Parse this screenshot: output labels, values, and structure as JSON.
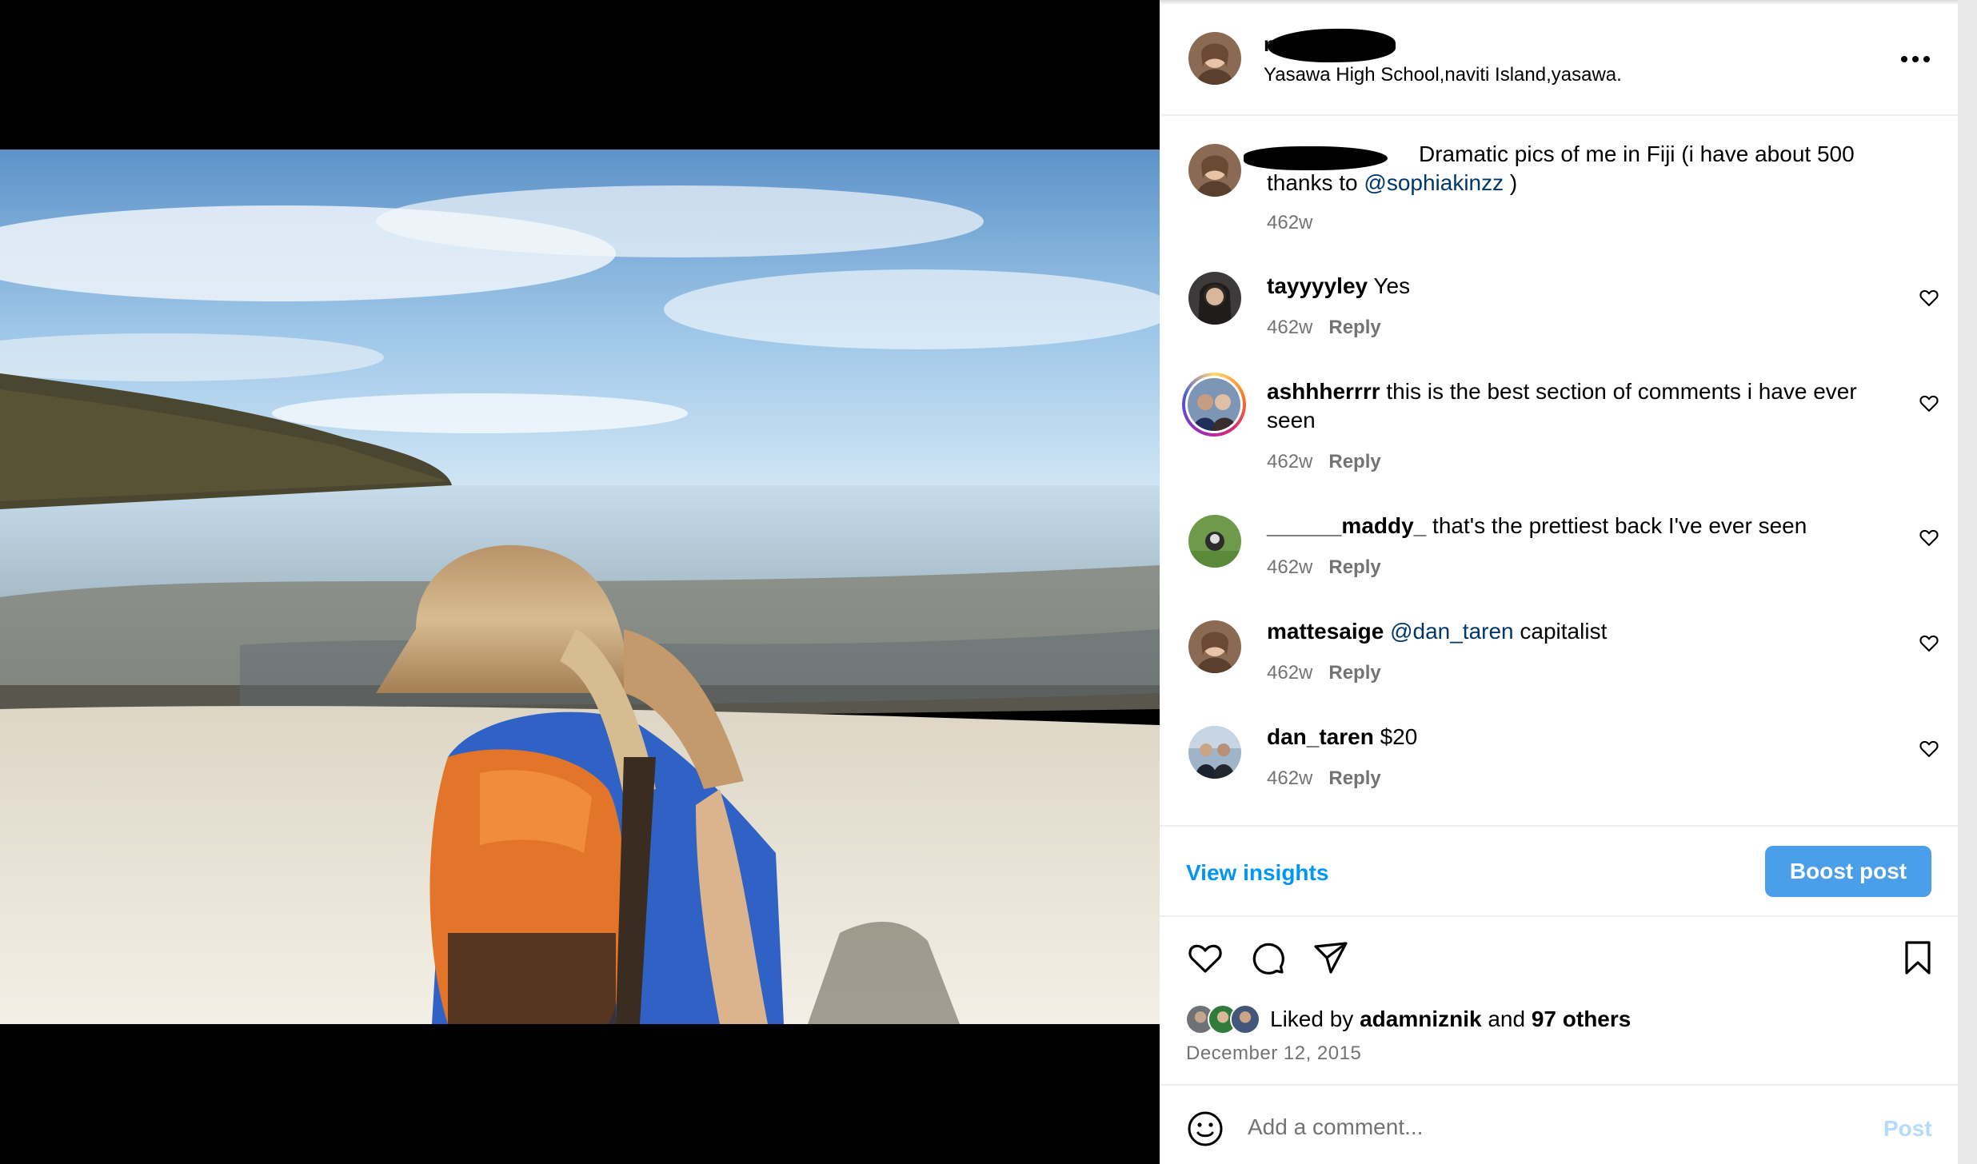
{
  "post": {
    "owner_username": "n",
    "location": "Yasawa High School,naviti Island,yasawa.",
    "more_icon": "more-horizontal-icon"
  },
  "caption": {
    "text_before": "Dramatic pics of me in Fiji (i have about 500",
    "text_line2": "thanks to ",
    "mention": "@sophiakinzz",
    "text_after": " )",
    "time": "462w"
  },
  "comments": [
    {
      "user": "tayyyyley",
      "text": "Yes",
      "time": "462w",
      "reply": "Reply"
    },
    {
      "user": "ashhherrrr",
      "text": "this is the best section of comments i have ever seen",
      "time": "462w",
      "reply": "Reply"
    },
    {
      "user": "______maddy_",
      "text": "that's the prettiest back I've ever seen",
      "time": "462w",
      "reply": "Reply"
    },
    {
      "user": "mattesaige",
      "mention": "@dan_taren",
      "text": "capitalist",
      "time": "462w",
      "reply": "Reply"
    },
    {
      "user": "dan_taren",
      "text": "$20",
      "time": "462w",
      "reply": "Reply"
    }
  ],
  "insights": {
    "view_label": "View insights",
    "boost_label": "Boost post"
  },
  "actions": [
    "heart-icon",
    "comment-icon",
    "share-icon",
    "bookmark-icon"
  ],
  "likes": {
    "prefix": "Liked by ",
    "user": "adamniznik",
    "middle": " and ",
    "others": "97 others"
  },
  "date": "December 12, 2015",
  "comment_box": {
    "placeholder": "Add a comment...",
    "post_label": "Post",
    "emoji_icon": "emoji-icon"
  },
  "colors": {
    "link_blue": "#0095f6",
    "boost_blue": "#4a9eea",
    "muted": "#737373",
    "mention": "#00376b"
  }
}
